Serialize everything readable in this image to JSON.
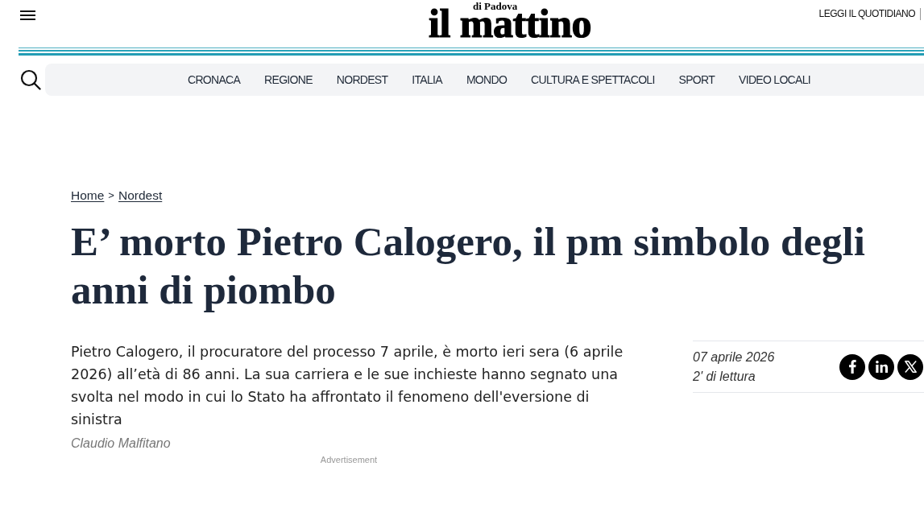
{
  "header": {
    "logo": {
      "wordmark": "il mattino",
      "edition": "di Padova"
    },
    "top_link": "LEGGI IL QUOTIDIANO"
  },
  "nav": {
    "items": [
      "CRONACA",
      "REGIONE",
      "NORDEST",
      "ITALIA",
      "MONDO",
      "CULTURA E SPETTACOLI",
      "SPORT",
      "VIDEO LOCALI"
    ]
  },
  "breadcrumb": {
    "items": [
      "Home",
      "Nordest"
    ],
    "separator": ">"
  },
  "article": {
    "title": "E’ morto Pietro Calogero, il pm simbolo degli anni di piombo",
    "summary": "Pietro Calogero, il procuratore del processo 7 aprile, è morto ieri sera (6 aprile 2026) all’età di 86 anni. La sua carriera e le sue inchieste hanno segnato una svolta nel modo in cui lo Stato ha affrontato il fenomeno dell'eversione di sinistra",
    "author": "Claudio Malfitano",
    "date": "07 aprile 2026",
    "reading_time": "2' di lettura",
    "share_buttons": [
      {
        "kind": "facebook"
      },
      {
        "kind": "linkedin"
      },
      {
        "kind": "x"
      }
    ]
  },
  "advertisement": {
    "label": "Advertisement"
  }
}
